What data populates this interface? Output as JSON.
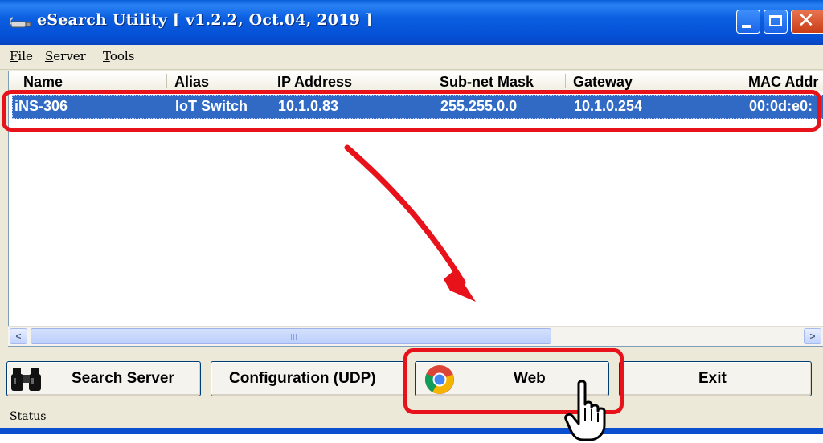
{
  "window": {
    "title": "eSearch Utility [ v1.2.2, Oct.04, 2019 ]"
  },
  "menu": {
    "items": [
      {
        "label_u": "F",
        "label_rest": "ile"
      },
      {
        "label_u": "S",
        "label_rest": "erver"
      },
      {
        "label_u": "T",
        "label_rest": "ools"
      }
    ]
  },
  "table": {
    "columns": [
      "Name",
      "Alias",
      "IP Address",
      "Sub-net Mask",
      "Gateway",
      "MAC Addr"
    ],
    "rows": [
      {
        "name": "iNS-306",
        "alias": "IoT Switch",
        "ip": "10.1.0.83",
        "mask": "255.255.0.0",
        "gateway": "10.1.0.254",
        "mac": "00:0d:e0:"
      }
    ],
    "selected_row": 0
  },
  "buttons": {
    "search_server": "Search Server",
    "configuration": "Configuration (UDP)",
    "web": "Web",
    "exit": "Exit"
  },
  "status": {
    "text": "Status"
  },
  "icons": {
    "app": "network-cable-icon",
    "search": "binoculars-icon",
    "web": "chrome-browser-icon",
    "cursor": "hand-pointer-icon"
  },
  "colors": {
    "titlebar": "#0550d6",
    "selection": "#316ac5",
    "annotation": "#e8121b"
  }
}
